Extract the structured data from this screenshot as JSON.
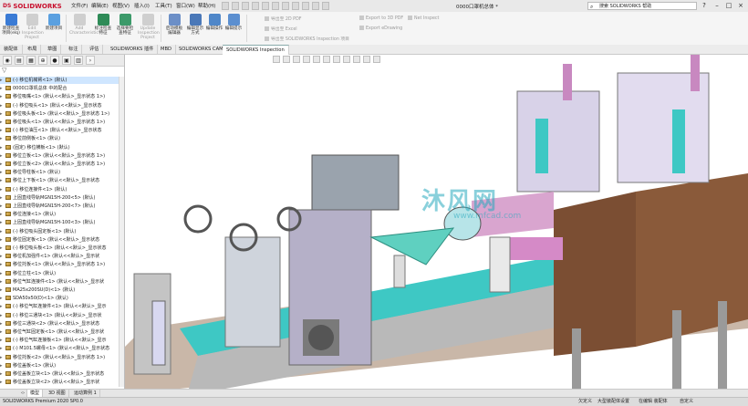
{
  "app": {
    "logo": "SOLIDWORKS",
    "logo_prefix": "DS",
    "document_title": "0000口罩机总体 *",
    "search_placeholder": "搜索 SOLIDWORKS 帮助"
  },
  "menu": [
    {
      "label": "文件(F)"
    },
    {
      "label": "编辑(E)"
    },
    {
      "label": "视图(V)"
    },
    {
      "label": "插入(I)"
    },
    {
      "label": "工具(T)"
    },
    {
      "label": "窗口(W)"
    },
    {
      "label": "帮助(H)"
    }
  ],
  "ribbon": {
    "buttons": [
      {
        "label": "新建检查项目(elq)",
        "enabled": true
      },
      {
        "label": "Edit Inspection Project",
        "enabled": false
      },
      {
        "label": "新建项目",
        "enabled": true
      },
      {
        "label": "Add Characteristic",
        "enabled": false
      },
      {
        "label": "标注检查特征",
        "enabled": true
      },
      {
        "label": "选择要检查特征",
        "enabled": true
      },
      {
        "label": "Update Inspection Project",
        "enabled": false
      },
      {
        "label": "启动模板编辑器",
        "enabled": true
      },
      {
        "label": "编辑显示方式",
        "enabled": true
      },
      {
        "label": "编辑操作",
        "enabled": true
      },
      {
        "label": "编辑提示",
        "enabled": true
      }
    ],
    "small_items": [
      {
        "label": "导出至 2D PDF"
      },
      {
        "label": "导出至 Excel"
      },
      {
        "label": "导出至 SOLIDWORKS Inspection 项目"
      },
      {
        "label": "Export to 3D PDF"
      },
      {
        "label": "Export eDrawing"
      },
      {
        "label": "Net Inspect"
      }
    ]
  },
  "tabs": [
    {
      "label": "装配体",
      "active": false
    },
    {
      "label": "布局",
      "active": false
    },
    {
      "label": "草图",
      "active": false
    },
    {
      "label": "标注",
      "active": false
    },
    {
      "label": "评估",
      "active": false
    },
    {
      "label": "SOLIDWORKS 插件",
      "active": false
    },
    {
      "label": "MBD",
      "active": false
    },
    {
      "label": "SOLIDWORKS CAM",
      "active": false
    },
    {
      "label": "SOLIDWORKS Inspection",
      "active": true
    }
  ],
  "tree": [
    {
      "label": "(-) 移位机械臂<1> (默认)",
      "root": true
    },
    {
      "label": "0000口罩机总体 中的配合"
    },
    {
      "label": "移位吸嘴<1> (默认<<默认>_显示状态 1>)"
    },
    {
      "label": "(-) 移位吸头<1> (默认<<默认>_显示状态"
    },
    {
      "label": "移位吸头板<1> (默认<<默认>_显示状态 1>)"
    },
    {
      "label": "移位吸头<1> (默认<<默认>_显示状态 1>)"
    },
    {
      "label": "(-) 移位油压<1> (默认<<默认>_显示状态"
    },
    {
      "label": "移位前侧板<1> (默认)"
    },
    {
      "label": "(固定) 移位横板<1> (默认)"
    },
    {
      "label": "移位立板<1> (默认<<默认>_显示状态 1>)"
    },
    {
      "label": "移位立板<2> (默认<<默认>_显示状态 1>)"
    },
    {
      "label": "移位导柱板<1> (默认)"
    },
    {
      "label": "移位上下板<1> (默认<<默认>_显示状态"
    },
    {
      "label": "(-) 移位连接件<1> (默认)"
    },
    {
      "label": "上固直线导轨MGN15H-200<5> (默认)"
    },
    {
      "label": "上固直线导轨MGN15H-200<7> (默认)"
    },
    {
      "label": "移位连接<1> (默认)"
    },
    {
      "label": "上固直线导轨MGN15H-100<3> (默认)"
    },
    {
      "label": "(-) 移位吸头固定板<1> (默认)"
    },
    {
      "label": "移位固定板<1> (默认<<默认>_显示状态"
    },
    {
      "label": "(-) 移位吸头板<1> (默认<<默认>_显示状态"
    },
    {
      "label": "移位机加强件<1> (默认<<默认>_显示状"
    },
    {
      "label": "移位托板<1> (默认<<默认>_显示状态 1>)"
    },
    {
      "label": "移位立柱<1> (默认)"
    },
    {
      "label": "移位气缸连接件<1> (默认<<默认>_显示状"
    },
    {
      "label": "MA25x200SU(D)<1> (默认)"
    },
    {
      "label": "SDA50x50(D)<1> (默认)"
    },
    {
      "label": "(-) 移位气缸连接件<1> (默认<<默认>_显示"
    },
    {
      "label": "(-) 移位三通块<1> (默认<<默认>_显示状"
    },
    {
      "label": "移位三通块<2> (默认<<默认>_显示状态"
    },
    {
      "label": "移位气缸固定板<1> (默认<<默认>_显示状"
    },
    {
      "label": "(-) 移位气缸连接板<1> (默认<<默认>_显示"
    },
    {
      "label": "(-) M101.5螺母<1> (默认<<默认>_显示状态"
    },
    {
      "label": "移位托板<2> (默认<<默认>_显示状态 1>)"
    },
    {
      "label": "移位盖板<1> (默认)"
    },
    {
      "label": "移位盖板立块<1> (默认<<默认>_显示状态"
    },
    {
      "label": "移位盖板立块<2> (默认<<默认>_显示状"
    }
  ],
  "viewport": {
    "watermark": "沐风网",
    "watermark_url": "www.mfcad.com"
  },
  "bottom_tabs": [
    {
      "label": "模型",
      "active": true
    },
    {
      "label": "3D 视图",
      "active": false
    },
    {
      "label": "运动算例 1",
      "active": false
    }
  ],
  "status": {
    "left": "SOLIDWORKS Premium 2020 SP0.0",
    "mode": "欠定义",
    "state": "大型装配体设置",
    "editing": "在编辑 装配体",
    "units": "自定义"
  },
  "colors": {
    "accent": "#c8102e",
    "tree_selected": "#cfe6ff",
    "belt_cyan": "#3ec8c4",
    "magenta_part": "#c888c0",
    "frame_brown": "#8a5a3a"
  }
}
